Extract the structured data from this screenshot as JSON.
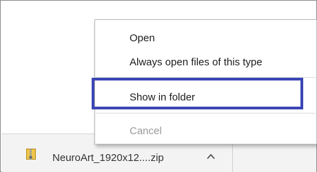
{
  "context_menu": {
    "items": [
      {
        "label": "Open",
        "enabled": true
      },
      {
        "label": "Always open files of this type",
        "enabled": true
      },
      {
        "label": "Show in folder",
        "enabled": true,
        "highlighted": true
      },
      {
        "label": "Cancel",
        "enabled": false
      }
    ]
  },
  "download_bar": {
    "file_name": "NeuroArt_1920x12....zip",
    "file_icon": "zip-archive-icon",
    "menu_toggle_icon": "chevron-up-icon"
  },
  "colors": {
    "highlight_border": "#3a46b5",
    "download_bar_bg": "#f3f3f3",
    "disabled_text": "#9a9a9a"
  }
}
